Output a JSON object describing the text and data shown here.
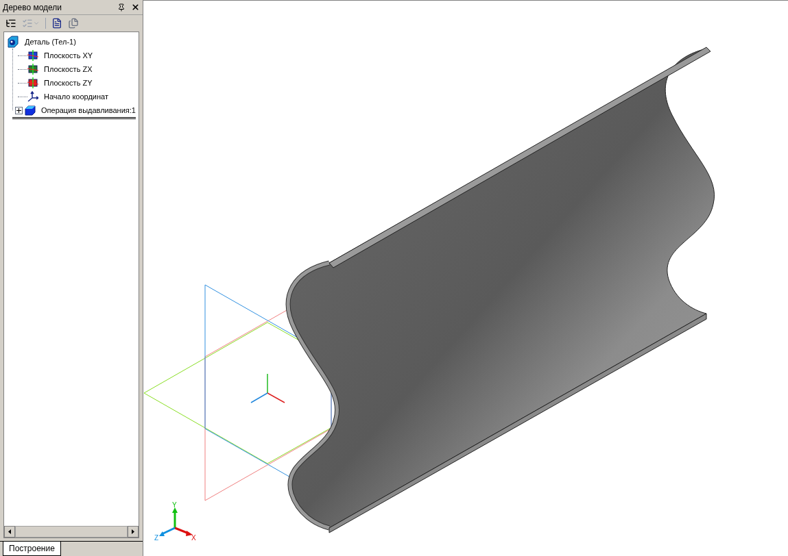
{
  "panel": {
    "title": "Дерево модели"
  },
  "tree": [
    {
      "label": "Деталь (Тел-1)",
      "kind": "part",
      "children": [
        {
          "label": "Плоскость XY",
          "kind": "plane-xy"
        },
        {
          "label": "Плоскость ZX",
          "kind": "plane-zx"
        },
        {
          "label": "Плоскость ZY",
          "kind": "plane-zy"
        },
        {
          "label": "Начало координат",
          "kind": "origin"
        },
        {
          "label": "Операция выдавливания:1",
          "kind": "extrusion",
          "expanded": false
        }
      ]
    }
  ],
  "tabs": [
    {
      "label": "Построение",
      "selected": true
    }
  ],
  "triad": {
    "x": "X",
    "y": "Y",
    "z": "Z"
  }
}
